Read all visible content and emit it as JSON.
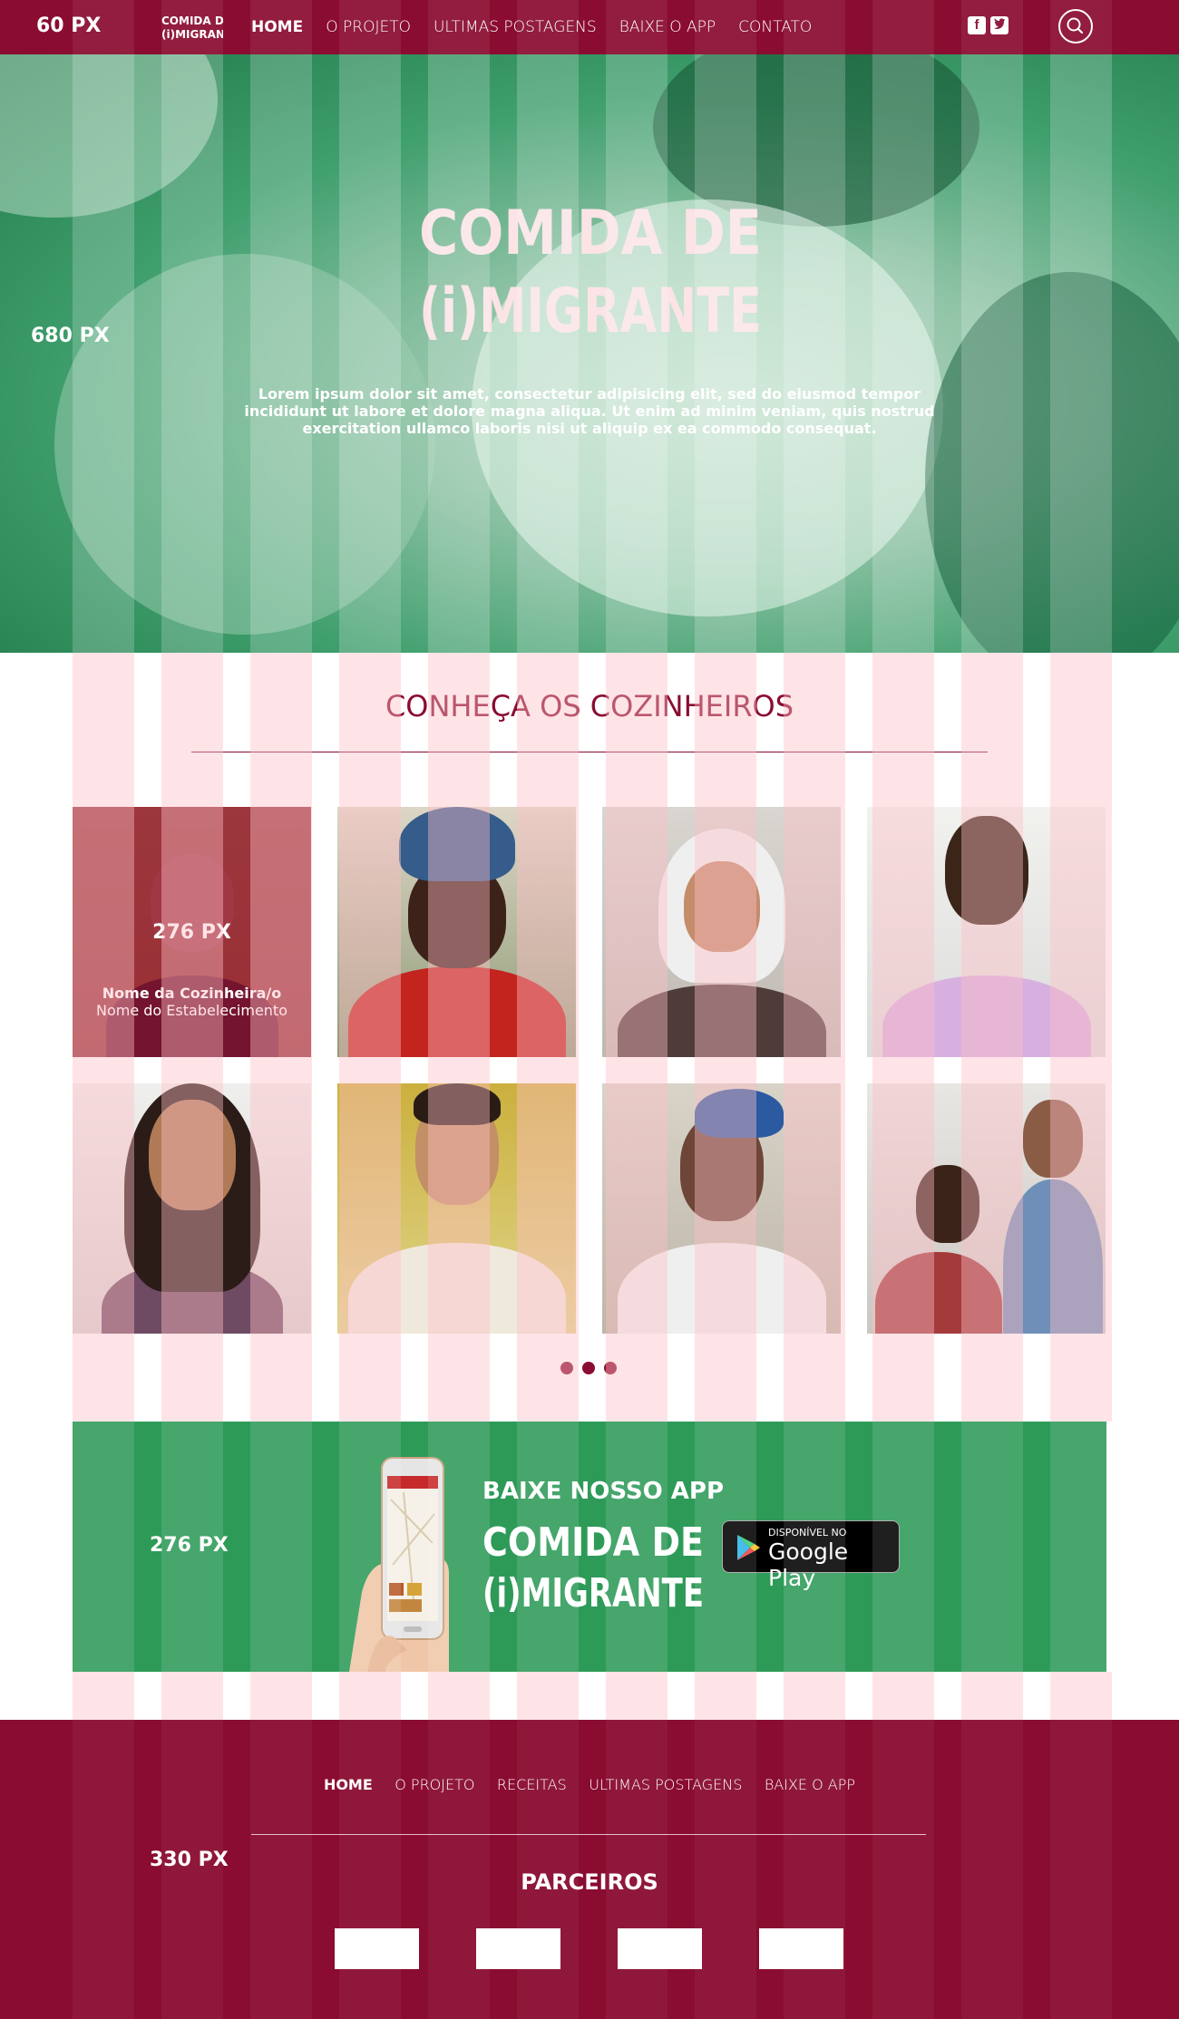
{
  "header": {
    "height_label": "60 PX",
    "logo_text": [
      "COMIDA DE",
      "(i)MIGRANTE"
    ],
    "nav": [
      "HOME",
      "O PROJETO",
      "ULTIMAS POSTAGENS",
      "BAIXE O APP",
      "CONTATO"
    ],
    "active_nav": "HOME",
    "social": [
      "facebook-icon",
      "twitter-icon"
    ],
    "search_icon": "search-icon"
  },
  "hero": {
    "height_label": "680 PX",
    "logo_line1": "COMIDA DE",
    "logo_line2": "(i)MIGRANTE",
    "text": "Lorem ipsum dolor sit amet, consectetur adipisicing elit, sed do eiusmod tempor incididunt ut labore et dolore magna aliqua. Ut enim ad minim veniam, quis nostrud exercitation ullamco laboris nisi ut aliquip ex ea commodo consequat."
  },
  "cooks": {
    "title": "CONHEÇA OS COZINHEIROS",
    "overlay": {
      "size_label": "276 PX",
      "name": "Nome da Cozinheira/o",
      "place": "Nome do Estabelecimento"
    },
    "carousel_dots": 3
  },
  "app": {
    "height_label": "276 PX",
    "title": "BAIXE NOSSO APP",
    "logo_line1": "COMIDA DE",
    "logo_line2": "(i)MIGRANTE",
    "store_small": "DISPONÍVEL NO",
    "store_big": "Google Play"
  },
  "footer": {
    "height_label": "330 PX",
    "nav": [
      "HOME",
      "O PROJETO",
      "RECEITAS",
      "ULTIMAS POSTAGENS",
      "BAIXE O APP"
    ],
    "active_nav": "HOME",
    "partners_title": "PARCEIROS",
    "partner_count": 4
  },
  "colors": {
    "brand": "#8a0c30",
    "green": "#2d9a58",
    "grid_pink": "#ffe3e6",
    "white": "#ffffff"
  }
}
